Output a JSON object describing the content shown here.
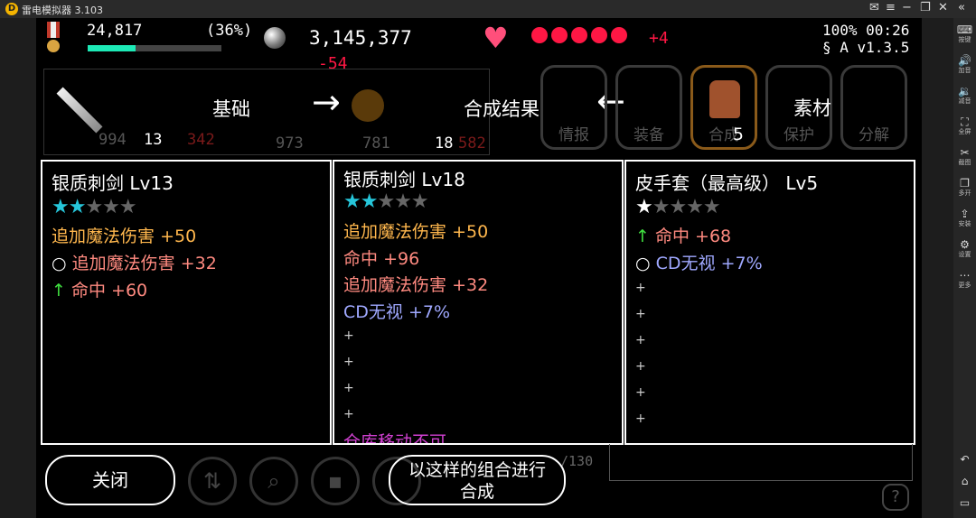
{
  "window": {
    "title": "雷电模拟器 3.103"
  },
  "hud": {
    "exp_value": "24,817",
    "exp_percent": "(36%)",
    "exp_progress": 0.36,
    "gems": "3,145,377",
    "gem_delta": "-54",
    "lives_extra": "+4",
    "battery_time": "100% 00:26",
    "version": "§ A v1.3.5"
  },
  "combine_bar": {
    "base_label": "基础",
    "result_label": "合成结果",
    "material_label": "素材",
    "slot_values": [
      "994",
      "13",
      "342",
      "973",
      "781",
      "18",
      "582"
    ]
  },
  "tabs": [
    {
      "label": "情报"
    },
    {
      "label": "装备"
    },
    {
      "label": "合成",
      "count": "5"
    },
    {
      "label": "保护"
    },
    {
      "label": "分解"
    }
  ],
  "panels": {
    "base": {
      "name": "银质刺剑",
      "level": "Lv13",
      "stars": "★★★★★",
      "lines": [
        {
          "prefix": "",
          "text": "追加魔法伤害",
          "value": "+50"
        },
        {
          "prefix": "○",
          "text": "追加魔法伤害",
          "value": "+32"
        },
        {
          "prefix": "↑",
          "text": "命中",
          "value": "+60"
        }
      ]
    },
    "result": {
      "name": "银质刺剑",
      "level": "Lv18",
      "stars": "★★★★★",
      "lines": [
        {
          "text": "追加魔法伤害",
          "value": "+50"
        },
        {
          "text": "命中",
          "value": "+96"
        },
        {
          "text": "追加魔法伤害",
          "value": "+32"
        },
        {
          "text": "CD无视",
          "value": "+7%"
        }
      ],
      "empty_slots": [
        "+",
        "+",
        "+",
        "+"
      ],
      "warning": "仓库移动不可"
    },
    "material": {
      "name": "皮手套（最高级）",
      "level": "Lv5",
      "stars": "★★★★★",
      "lines": [
        {
          "prefix": "↑",
          "text": "命中",
          "value": "+68"
        },
        {
          "prefix": "○",
          "text": "CD无视",
          "value": "+7%"
        }
      ],
      "empty_slots": [
        "+",
        "+",
        "+",
        "+",
        "+",
        "+"
      ]
    }
  },
  "bottom": {
    "close_label": "关闭",
    "confirm_label_1": "以这样的组合进行",
    "confirm_label_2": "合成",
    "inventory_count": "/130",
    "help_label": "?"
  },
  "sidebar": [
    {
      "label": "按键",
      "icon": "⌨"
    },
    {
      "label": "加音",
      "icon": "🔊"
    },
    {
      "label": "减音",
      "icon": "🔉"
    },
    {
      "label": "全屏",
      "icon": "⛶"
    },
    {
      "label": "截图",
      "icon": "✂"
    },
    {
      "label": "多开",
      "icon": "❐"
    },
    {
      "label": "安装",
      "icon": "⇪"
    },
    {
      "label": "设置",
      "icon": "⚙"
    },
    {
      "label": "更多",
      "icon": "⋯"
    }
  ],
  "colors": {
    "cyan_star": "#26c6da",
    "orange": "#ffb74d",
    "pink": "#ff8a80",
    "blue": "#9fa8ff",
    "green": "#40e040",
    "red": "#ff1744",
    "heart": "#ff4f7b"
  }
}
